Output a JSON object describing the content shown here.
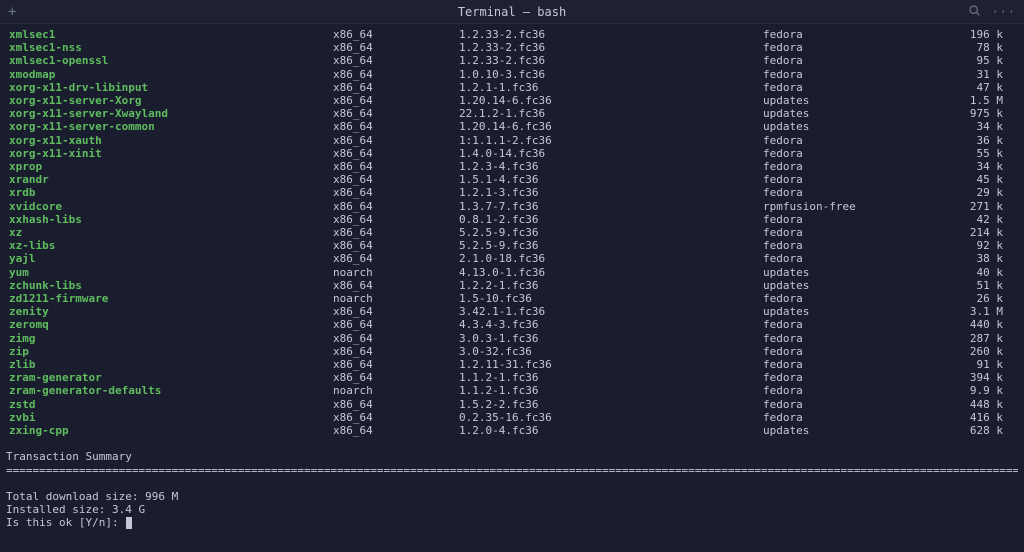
{
  "titlebar": {
    "title": "Terminal — bash",
    "new_tab": "+",
    "more": "···"
  },
  "packages": [
    {
      "name": "xmlsec1",
      "arch": "x86_64",
      "version": "1.2.33-2.fc36",
      "repo": "fedora",
      "size": "196 k"
    },
    {
      "name": "xmlsec1-nss",
      "arch": "x86_64",
      "version": "1.2.33-2.fc36",
      "repo": "fedora",
      "size": "78 k"
    },
    {
      "name": "xmlsec1-openssl",
      "arch": "x86_64",
      "version": "1.2.33-2.fc36",
      "repo": "fedora",
      "size": "95 k"
    },
    {
      "name": "xmodmap",
      "arch": "x86_64",
      "version": "1.0.10-3.fc36",
      "repo": "fedora",
      "size": "31 k"
    },
    {
      "name": "xorg-x11-drv-libinput",
      "arch": "x86_64",
      "version": "1.2.1-1.fc36",
      "repo": "fedora",
      "size": "47 k"
    },
    {
      "name": "xorg-x11-server-Xorg",
      "arch": "x86_64",
      "version": "1.20.14-6.fc36",
      "repo": "updates",
      "size": "1.5 M"
    },
    {
      "name": "xorg-x11-server-Xwayland",
      "arch": "x86_64",
      "version": "22.1.2-1.fc36",
      "repo": "updates",
      "size": "975 k"
    },
    {
      "name": "xorg-x11-server-common",
      "arch": "x86_64",
      "version": "1.20.14-6.fc36",
      "repo": "updates",
      "size": "34 k"
    },
    {
      "name": "xorg-x11-xauth",
      "arch": "x86_64",
      "version": "1:1.1.1-2.fc36",
      "repo": "fedora",
      "size": "36 k"
    },
    {
      "name": "xorg-x11-xinit",
      "arch": "x86_64",
      "version": "1.4.0-14.fc36",
      "repo": "fedora",
      "size": "55 k"
    },
    {
      "name": "xprop",
      "arch": "x86_64",
      "version": "1.2.3-4.fc36",
      "repo": "fedora",
      "size": "34 k"
    },
    {
      "name": "xrandr",
      "arch": "x86_64",
      "version": "1.5.1-4.fc36",
      "repo": "fedora",
      "size": "45 k"
    },
    {
      "name": "xrdb",
      "arch": "x86_64",
      "version": "1.2.1-3.fc36",
      "repo": "fedora",
      "size": "29 k"
    },
    {
      "name": "xvidcore",
      "arch": "x86_64",
      "version": "1.3.7-7.fc36",
      "repo": "rpmfusion-free",
      "size": "271 k"
    },
    {
      "name": "xxhash-libs",
      "arch": "x86_64",
      "version": "0.8.1-2.fc36",
      "repo": "fedora",
      "size": "42 k"
    },
    {
      "name": "xz",
      "arch": "x86_64",
      "version": "5.2.5-9.fc36",
      "repo": "fedora",
      "size": "214 k"
    },
    {
      "name": "xz-libs",
      "arch": "x86_64",
      "version": "5.2.5-9.fc36",
      "repo": "fedora",
      "size": "92 k"
    },
    {
      "name": "yajl",
      "arch": "x86_64",
      "version": "2.1.0-18.fc36",
      "repo": "fedora",
      "size": "38 k"
    },
    {
      "name": "yum",
      "arch": "noarch",
      "version": "4.13.0-1.fc36",
      "repo": "updates",
      "size": "40 k"
    },
    {
      "name": "zchunk-libs",
      "arch": "x86_64",
      "version": "1.2.2-1.fc36",
      "repo": "updates",
      "size": "51 k"
    },
    {
      "name": "zd1211-firmware",
      "arch": "noarch",
      "version": "1.5-10.fc36",
      "repo": "fedora",
      "size": "26 k"
    },
    {
      "name": "zenity",
      "arch": "x86_64",
      "version": "3.42.1-1.fc36",
      "repo": "updates",
      "size": "3.1 M"
    },
    {
      "name": "zeromq",
      "arch": "x86_64",
      "version": "4.3.4-3.fc36",
      "repo": "fedora",
      "size": "440 k"
    },
    {
      "name": "zimg",
      "arch": "x86_64",
      "version": "3.0.3-1.fc36",
      "repo": "fedora",
      "size": "287 k"
    },
    {
      "name": "zip",
      "arch": "x86_64",
      "version": "3.0-32.fc36",
      "repo": "fedora",
      "size": "260 k"
    },
    {
      "name": "zlib",
      "arch": "x86_64",
      "version": "1.2.11-31.fc36",
      "repo": "fedora",
      "size": "91 k"
    },
    {
      "name": "zram-generator",
      "arch": "x86_64",
      "version": "1.1.2-1.fc36",
      "repo": "fedora",
      "size": "394 k"
    },
    {
      "name": "zram-generator-defaults",
      "arch": "noarch",
      "version": "1.1.2-1.fc36",
      "repo": "fedora",
      "size": "9.9 k"
    },
    {
      "name": "zstd",
      "arch": "x86_64",
      "version": "1.5.2-2.fc36",
      "repo": "fedora",
      "size": "448 k"
    },
    {
      "name": "zvbi",
      "arch": "x86_64",
      "version": "0.2.35-16.fc36",
      "repo": "fedora",
      "size": "416 k"
    },
    {
      "name": "zxing-cpp",
      "arch": "x86_64",
      "version": "1.2.0-4.fc36",
      "repo": "updates",
      "size": "628 k"
    }
  ],
  "summary": {
    "header": "Transaction Summary",
    "download_size": "Total download size: 996 M",
    "installed_size": "Installed size: 3.4 G",
    "prompt": "Is this ok [Y/n]: "
  }
}
